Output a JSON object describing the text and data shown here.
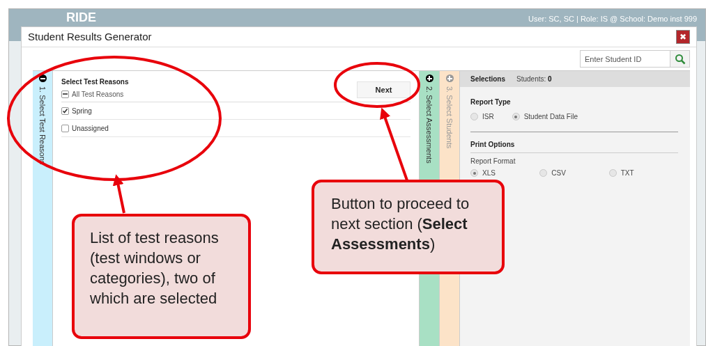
{
  "background_app": {
    "logo": "RIDE",
    "user_info": "User: SC, SC  |  Role: IS @ School: Demo inst 999"
  },
  "window": {
    "title": "Student Results Generator",
    "close": "✖"
  },
  "search": {
    "placeholder": "Enter Student ID"
  },
  "steps": [
    {
      "label": "1. Select Test Reasons",
      "expanded": true,
      "color": "#c9effc"
    },
    {
      "label": "2. Select Assessments",
      "expanded": false,
      "color": "#a8e0c4"
    },
    {
      "label": "3. Select Students",
      "expanded": false,
      "color": "#fce3c8"
    }
  ],
  "test_reasons": {
    "heading": "Select Test Reasons",
    "all": {
      "label": "All Test Reasons",
      "partially_checked": true
    },
    "items": [
      {
        "label": "Spring",
        "checked": true
      },
      {
        "label": "Unassigned",
        "checked": false
      }
    ]
  },
  "next_button": "Next",
  "selections": {
    "heading": "Selections",
    "students_label": "Students:",
    "students_count": "0",
    "report_type": {
      "heading": "Report Type",
      "options": [
        {
          "label": "ISR",
          "selected": false
        },
        {
          "label": "Student Data File",
          "selected": true
        }
      ]
    },
    "print_options": {
      "heading": "Print Options",
      "format_label": "Report Format",
      "options": [
        {
          "label": "XLS",
          "selected": true
        },
        {
          "label": "CSV",
          "selected": false
        },
        {
          "label": "TXT",
          "selected": false
        }
      ]
    }
  },
  "callouts": [
    {
      "text": "List of test reasons (test windows or categories), two of which are selected"
    },
    {
      "text": "Button to proceed to next section (**Select Assessments**)"
    }
  ]
}
